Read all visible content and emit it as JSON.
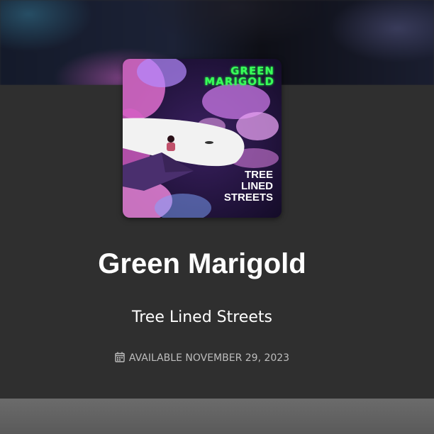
{
  "album_art": {
    "artist_text_line1": "GREEN",
    "artist_text_line2": "MARIGOLD",
    "album_text_line1": "TREE",
    "album_text_line2": "LINED",
    "album_text_line3": "STREETS",
    "colors": {
      "artist_text": "#39ff5a",
      "album_text": "#ffffff",
      "background": "#2a1a45",
      "cloud": "#e06fcf",
      "whale": "#f2f2f2"
    }
  },
  "release": {
    "title": "Green Marigold",
    "subtitle": "Tree Lined Streets",
    "availability": "AVAILABLE NOVEMBER 29, 2023",
    "icon": "calendar-icon"
  },
  "theme": {
    "panel": "#2f2f2f",
    "title_color": "#ffffff",
    "meta_color": "#bdbdbd"
  }
}
